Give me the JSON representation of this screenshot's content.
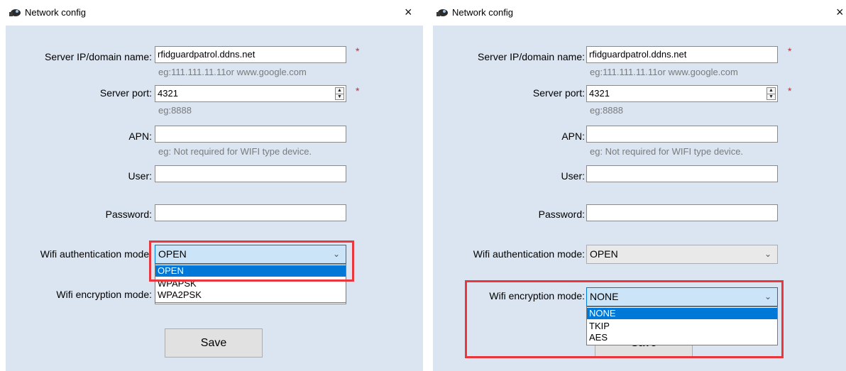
{
  "window": {
    "title": "Network config",
    "close_glyph": "×"
  },
  "form": {
    "server_label": "Server IP/domain name:",
    "server_value": "rfidguardpatrol.ddns.net",
    "server_hint": "eg:111.111.11.11or www.google.com",
    "port_label": "Server port:",
    "port_value": "4321",
    "port_hint": "eg:8888",
    "apn_label": "APN:",
    "apn_value": "",
    "apn_hint": "eg: Not required for WIFI type device.",
    "user_label": "User:",
    "user_value": "",
    "password_label": "Password:",
    "password_value": "",
    "wifi_auth_label": "Wifi authentication mode:",
    "wifi_auth_value": "OPEN",
    "wifi_enc_label": "Wifi encryption mode:",
    "wifi_enc_value": "NONE",
    "required_mark": "*",
    "save_label": "Save"
  },
  "left_dropdown": {
    "options": [
      "OPEN",
      "WPAPSK",
      "WPA2PSK"
    ],
    "selected": "OPEN"
  },
  "right_dropdown": {
    "options": [
      "NONE",
      "TKIP",
      "AES"
    ],
    "selected": "NONE"
  },
  "colors": {
    "highlight": "#e8383d",
    "selection": "#0078d7",
    "client_bg": "#dbe5f1"
  },
  "icons": {
    "app": "network-app-icon",
    "close": "close-icon",
    "chevron": "chevron-down-icon",
    "spinner": "spinner-arrows-icon"
  }
}
